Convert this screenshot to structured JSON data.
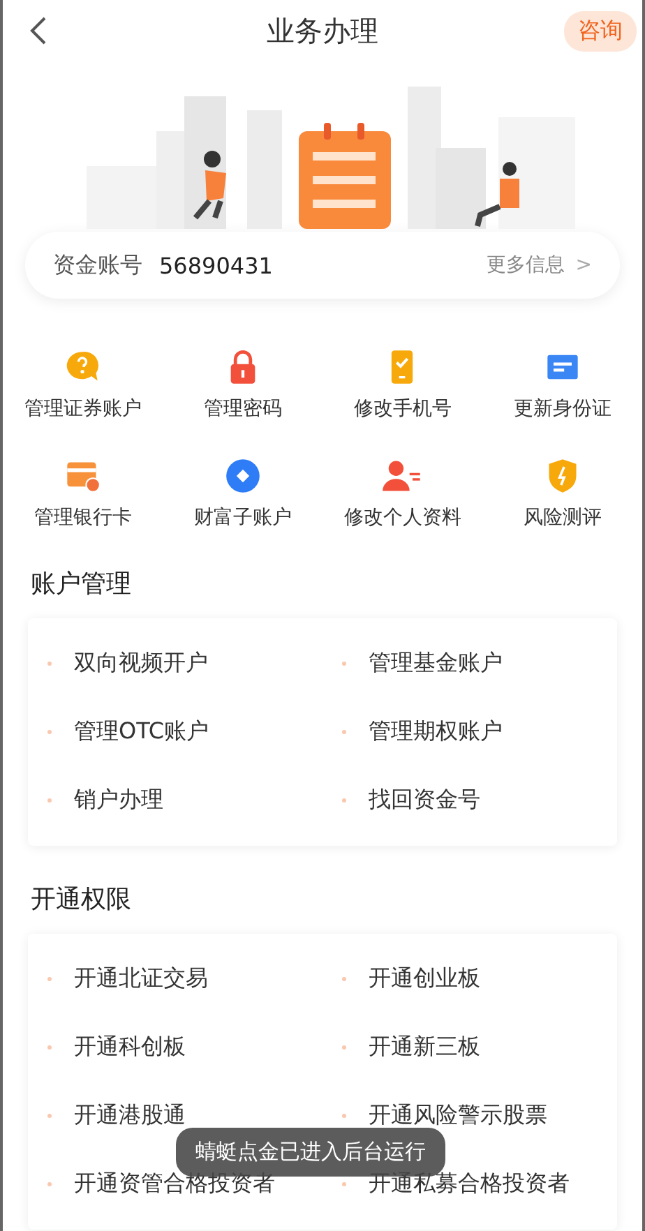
{
  "header": {
    "title": "业务办理",
    "action": "咨询"
  },
  "account": {
    "label": "资金账号",
    "number": "56890431",
    "more": "更多信息",
    "chevron": ">"
  },
  "shortcuts": [
    {
      "label": "管理证券账户"
    },
    {
      "label": "管理密码"
    },
    {
      "label": "修改手机号"
    },
    {
      "label": "更新身份证"
    },
    {
      "label": "管理银行卡"
    },
    {
      "label": "财富子账户"
    },
    {
      "label": "修改个人资料"
    },
    {
      "label": "风险测评"
    }
  ],
  "sections": [
    {
      "title": "账户管理",
      "items": [
        "双向视频开户",
        "管理基金账户",
        "管理OTC账户",
        "管理期权账户",
        "销户办理",
        "找回资金号"
      ]
    },
    {
      "title": "开通权限",
      "items": [
        "开通北证交易",
        "开通创业板",
        "开通科创板",
        "开通新三板",
        "开通港股通",
        "开通风险警示股票",
        "开通资管合格投资者",
        "开通私募合格投资者"
      ]
    }
  ],
  "toast": "蜻蜓点金已进入后台运行"
}
